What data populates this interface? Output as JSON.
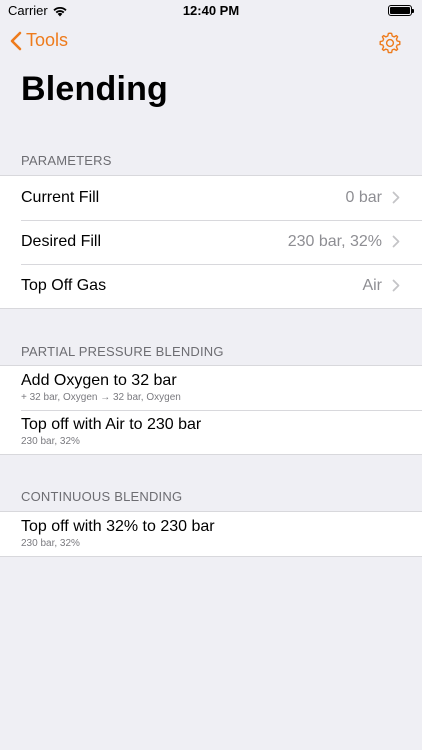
{
  "status_bar": {
    "carrier": "Carrier",
    "time": "12:40 PM"
  },
  "nav": {
    "back_label": "Tools"
  },
  "page": {
    "title": "Blending"
  },
  "parameters": {
    "header": "PARAMETERS",
    "rows": [
      {
        "label": "Current Fill",
        "value": "0 bar"
      },
      {
        "label": "Desired Fill",
        "value": "230 bar, 32%"
      },
      {
        "label": "Top Off Gas",
        "value": "Air"
      }
    ]
  },
  "partial_pressure": {
    "header": "PARTIAL PRESSURE BLENDING",
    "rows": [
      {
        "title": "Add Oxygen to 32 bar",
        "subtitle": "+ 32 bar, Oxygen → 32 bar, Oxygen"
      },
      {
        "title": "Top off with Air to 230 bar",
        "subtitle": "230 bar, 32%"
      }
    ]
  },
  "continuous": {
    "header": "CONTINUOUS BLENDING",
    "rows": [
      {
        "title": "Top off with 32% to 230 bar",
        "subtitle": "230 bar, 32%"
      }
    ]
  },
  "colors": {
    "accent": "#ee7b1c",
    "background": "#efeff4",
    "secondary_text": "#8e8e93"
  },
  "icons": [
    "wifi-icon",
    "battery-icon",
    "chevron-left-icon",
    "gear-icon",
    "chevron-right-icon"
  ]
}
